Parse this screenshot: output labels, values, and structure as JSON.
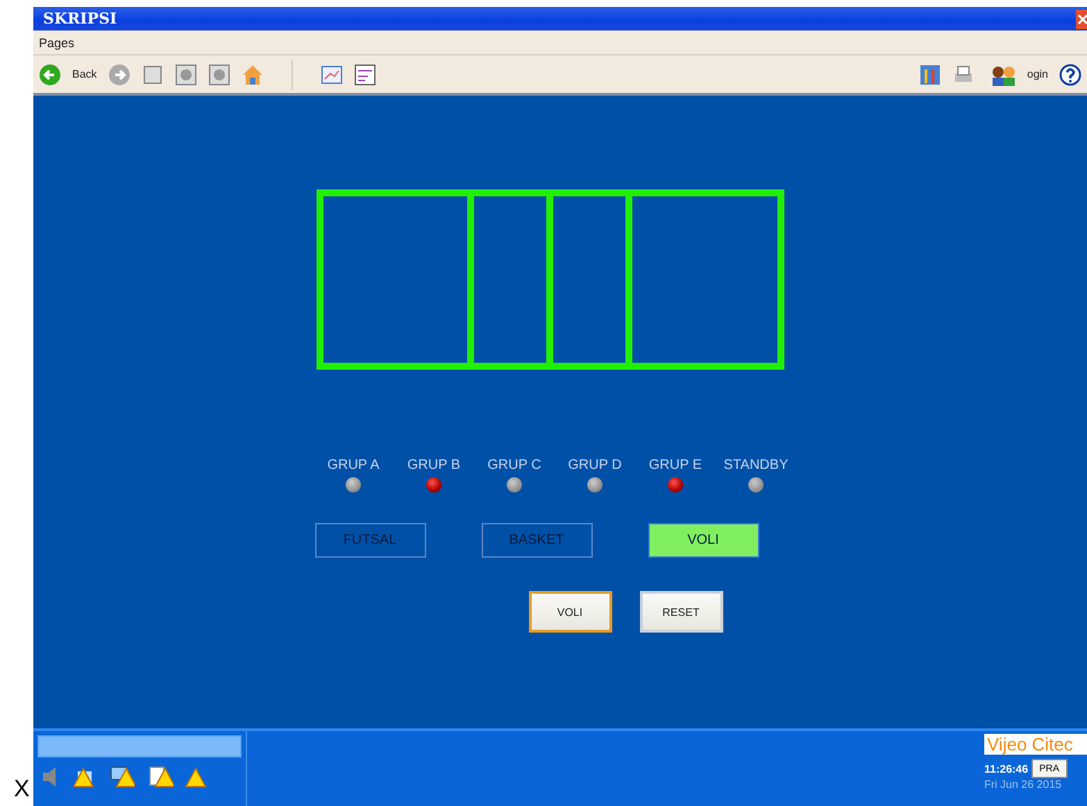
{
  "window": {
    "title": "SKRIPSI"
  },
  "menu": [
    "Pages"
  ],
  "toolbar": {
    "back_label": "Back",
    "login_label": "ogin"
  },
  "indicators": [
    {
      "label": "GRUP A",
      "on": false
    },
    {
      "label": "GRUP B",
      "on": true
    },
    {
      "label": "GRUP C",
      "on": false
    },
    {
      "label": "GRUP D",
      "on": false
    },
    {
      "label": "GRUP E",
      "on": true
    },
    {
      "label": "STANDBY",
      "on": false
    }
  ],
  "modes": [
    {
      "label": "FUTSAL",
      "selected": false
    },
    {
      "label": "BASKET",
      "selected": false
    },
    {
      "label": "VOLI",
      "selected": true
    }
  ],
  "actions": [
    {
      "label": "VOLI",
      "focused": true
    },
    {
      "label": "RESET",
      "focused": false
    }
  ],
  "status": {
    "brand": "Vijeo Citec",
    "time": "11:26:46",
    "button": "PRA",
    "date": "Fri Jun 26 2015"
  },
  "margin_mark": "X"
}
